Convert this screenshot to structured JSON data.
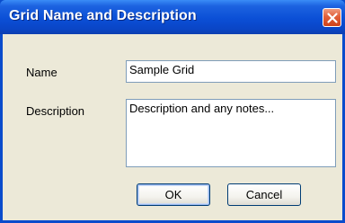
{
  "dialog": {
    "title": "Grid Name and Description",
    "close_icon": "close-x-icon"
  },
  "fields": {
    "name_label": "Name",
    "name_value": "Sample Grid",
    "description_label": "Description",
    "description_value": "Description and any notes..."
  },
  "buttons": {
    "ok_label": "OK",
    "cancel_label": "Cancel"
  },
  "colors": {
    "titlebar": "#0a4ccc",
    "close_button": "#e2603a",
    "client_background": "#ece9d8"
  }
}
